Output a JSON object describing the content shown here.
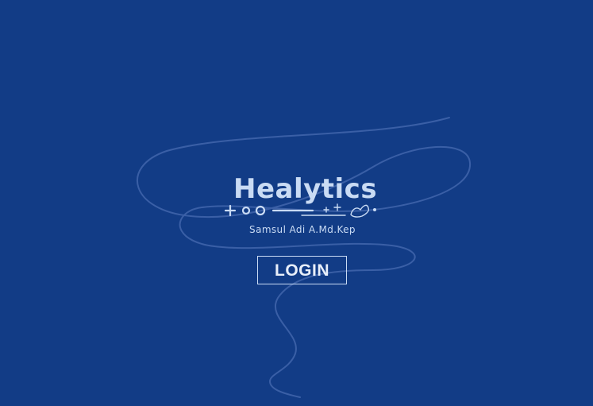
{
  "app": {
    "logo_text": "Healytics",
    "subtitle": "Samsul Adi A.Md.Kep"
  },
  "actions": {
    "login_label": "LOGIN"
  },
  "colors": {
    "background": "#123c86",
    "accent": "#c9dbf4",
    "decorative_line": "#3a5fa6"
  },
  "icons": {
    "logo_symbols": [
      "plus-icon",
      "ring-icon",
      "ring-icon",
      "line",
      "plus-icon",
      "plus-icon",
      "dove-icon",
      "dot-icon"
    ]
  }
}
